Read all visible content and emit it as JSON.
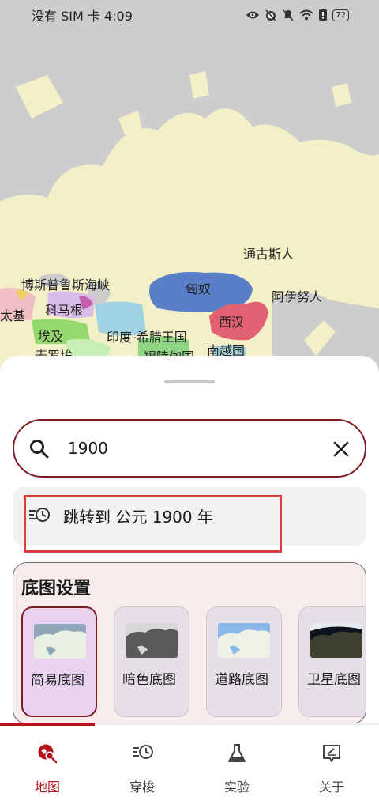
{
  "status_bar": {
    "left_text": "没有 SIM 卡 4:09",
    "battery": "72",
    "icons": [
      "eye-icon",
      "alarm-off-icon",
      "bell-off-icon",
      "wifi-icon",
      "battery-alert-icon"
    ]
  },
  "map": {
    "labels": {
      "tongus": "通古斯人",
      "bosporus": "博斯普鲁斯海峡",
      "xiongnu": "匈奴",
      "ainu": "阿伊努人",
      "carthage": "太基",
      "commagene": "科马根",
      "western_han": "西汉",
      "egypt": "埃及",
      "indo_greek": "印度-希腊王国",
      "nanyue": "南越国",
      "meroe": "麦罗埃",
      "chera": "羯陵伽国"
    }
  },
  "search": {
    "value": "1900",
    "placeholder": "",
    "icon": "search-icon",
    "clear_icon": "close-icon"
  },
  "jump": {
    "text": "跳转到 公元 1900 年",
    "icon": "history-clock-icon"
  },
  "basemap": {
    "title": "底图设置",
    "options": [
      {
        "label": "简易底图",
        "selected": true
      },
      {
        "label": "暗色底图",
        "selected": false
      },
      {
        "label": "道路底图",
        "selected": false
      },
      {
        "label": "卫星底图",
        "selected": false
      }
    ]
  },
  "tabs": [
    {
      "label": "地图",
      "icon": "map-search-icon",
      "active": true
    },
    {
      "label": "穿梭",
      "icon": "history-clock-icon",
      "active": false
    },
    {
      "label": "实验",
      "icon": "flask-icon",
      "active": false
    },
    {
      "label": "关于",
      "icon": "info-edit-icon",
      "active": false
    }
  ],
  "colors": {
    "accent": "#7d1c22",
    "active_tab": "#b5121b",
    "highlight_box": "#e0393f",
    "land": "#f3f0c8",
    "sea": "#cdcdcd"
  }
}
